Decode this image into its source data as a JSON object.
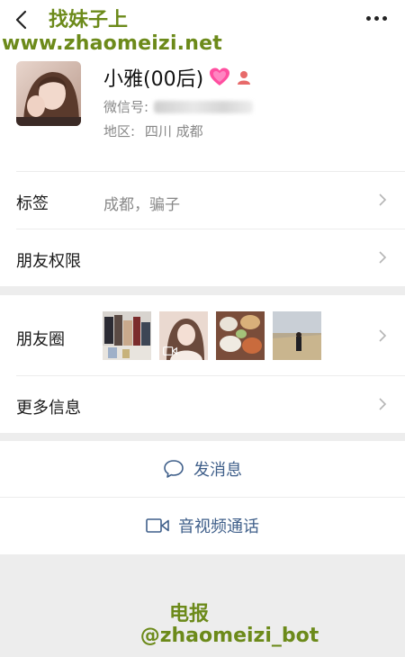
{
  "watermark": {
    "title": "找妹子上",
    "url": "www.zhaomeizi.net",
    "telegram_label": "电报",
    "telegram_handle": "@zhaomeizi_bot"
  },
  "header": {
    "back_icon": "chevron-left-icon",
    "more_icon": "more-dots-icon"
  },
  "profile": {
    "name": "小雅(00后)",
    "wechat_id_label": "微信号:",
    "region_label": "地区:",
    "region_value": "四川  成都",
    "emoji": "pink-heart-icon",
    "gender_icon": "female-icon"
  },
  "rows": {
    "tags_label": "标签",
    "tags_value": "成都，骗子",
    "friend_permissions_label": "朋友权限",
    "moments_label": "朋友圈",
    "more_info_label": "更多信息"
  },
  "actions": {
    "send_message": "发消息",
    "av_call": "音视频通话"
  },
  "colors": {
    "watermark": "#6c8a1a",
    "action_blue": "#3f5f8a",
    "secondary_text": "#888888",
    "band_gray": "#ededed"
  }
}
